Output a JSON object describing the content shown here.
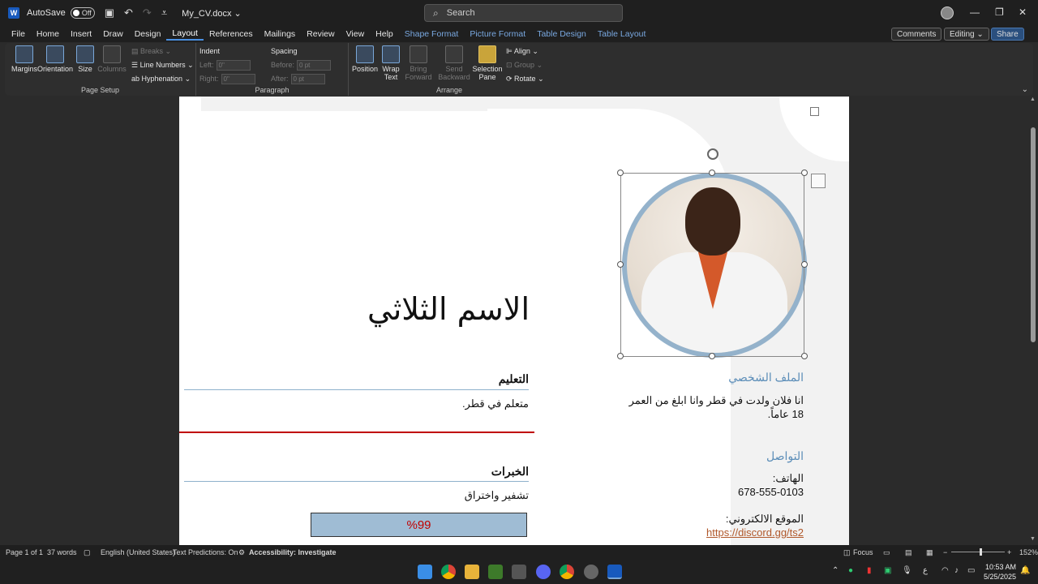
{
  "titlebar": {
    "autosave_label": "AutoSave",
    "autosave_state": "Off",
    "document_name": "My_CV.docx",
    "search_placeholder": "Search"
  },
  "menu": {
    "tabs": [
      "File",
      "Home",
      "Insert",
      "Draw",
      "Design",
      "Layout",
      "References",
      "Mailings",
      "Review",
      "View",
      "Help"
    ],
    "active_tab": "Layout",
    "context_tabs": [
      "Shape Format",
      "Picture Format",
      "Table Design",
      "Table Layout"
    ],
    "comments": "Comments",
    "editing": "Editing",
    "share": "Share"
  },
  "ribbon": {
    "page_setup": {
      "label": "Page Setup",
      "margins": "Margins",
      "orientation": "Orientation",
      "size": "Size",
      "columns": "Columns",
      "breaks": "Breaks",
      "line_numbers": "Line Numbers",
      "hyphenation": "Hyphenation"
    },
    "paragraph": {
      "label": "Paragraph",
      "indent": "Indent",
      "spacing": "Spacing",
      "left": "Left:",
      "right": "Right:",
      "before": "Before:",
      "after": "After:",
      "left_value": "0\"",
      "right_value": "0\"",
      "before_value": "0 pt",
      "after_value": "0 pt"
    },
    "arrange": {
      "label": "Arrange",
      "position": "Position",
      "wrap_text_1": "Wrap",
      "wrap_text_2": "Text",
      "bring_forward_1": "Bring",
      "bring_forward_2": "Forward",
      "send_backward_1": "Send",
      "send_backward_2": "Backward",
      "selection_pane_1": "Selection",
      "selection_pane_2": "Pane",
      "align": "Align",
      "group": "Group",
      "rotate": "Rotate"
    }
  },
  "document": {
    "name": "الاسم الثلاثي",
    "education_heading": "التعليم",
    "education_text": "متعلم في قطر.",
    "experience_heading": "الخبرات",
    "experience_text": "تشفير واختراق",
    "skill_percent": "%99",
    "profile_heading": "الملف الشخصي",
    "profile_text": "انا فلان ولدت في قطر وانا ابلغ من العمر 18 عاماً.",
    "contact_heading": "التواصل",
    "phone_label": "الهاتف:",
    "phone_value": "678-555-0103",
    "website_label": "الموقع الالكتروني:",
    "website_value": "https://discord.gg/ts2"
  },
  "statusbar": {
    "page": "Page 1 of 1",
    "words": "37 words",
    "language": "English (United States)",
    "text_predictions": "Text Predictions: On",
    "accessibility": "Accessibility: Investigate",
    "focus": "Focus",
    "zoom": "152%"
  },
  "taskbar": {
    "time": "10:53 AM",
    "date": "5/25/2025",
    "lang": "ع"
  },
  "colors": {
    "accent": "#4a90e2",
    "heading_blue": "#5b8db8",
    "red_line": "#c00000",
    "skill_bar": "#9fbcd4",
    "link": "#b0582b"
  }
}
